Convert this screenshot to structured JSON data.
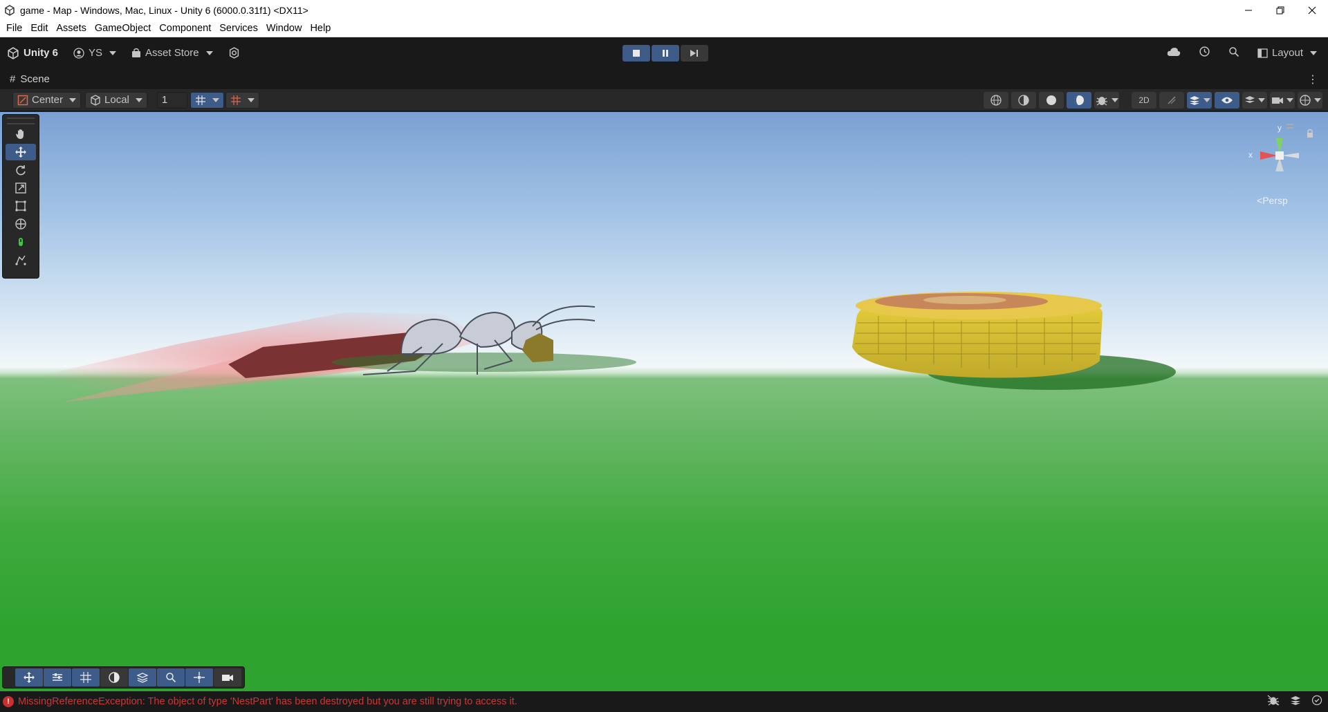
{
  "window": {
    "title": "game - Map - Windows, Mac, Linux - Unity 6 (6000.0.31f1) <DX11>",
    "app_icon": "unity-icon",
    "controls": [
      "minimize",
      "restore",
      "close"
    ]
  },
  "menu": {
    "items": [
      "File",
      "Edit",
      "Assets",
      "GameObject",
      "Component",
      "Services",
      "Window",
      "Help"
    ]
  },
  "toolbar": {
    "unity_label": "Unity 6",
    "account_label": "YS",
    "asset_store_label": "Asset Store",
    "layout_label": "Layout",
    "play_buttons": [
      "stop",
      "pause",
      "step"
    ]
  },
  "scene": {
    "tab_label": "Scene",
    "pivot_mode": "Center",
    "pivot_rotation": "Local",
    "grid_value": "1",
    "persp_label": "Persp",
    "gizmo_axes": {
      "x": "x",
      "y": "y"
    }
  },
  "tools": [
    "view-hand",
    "move",
    "rotate",
    "scale",
    "rect",
    "transform",
    "custom-editor",
    "nav-agent"
  ],
  "overlays": [
    "move-overlay",
    "properties",
    "grid",
    "shading",
    "layers",
    "search",
    "snap",
    "camera"
  ],
  "status": {
    "error_message": "MissingReferenceException: The object of type 'NestPart' has been destroyed but you are still trying to access it.",
    "colors": {
      "error": "#d03434",
      "accent": "#3d5c8a"
    }
  }
}
